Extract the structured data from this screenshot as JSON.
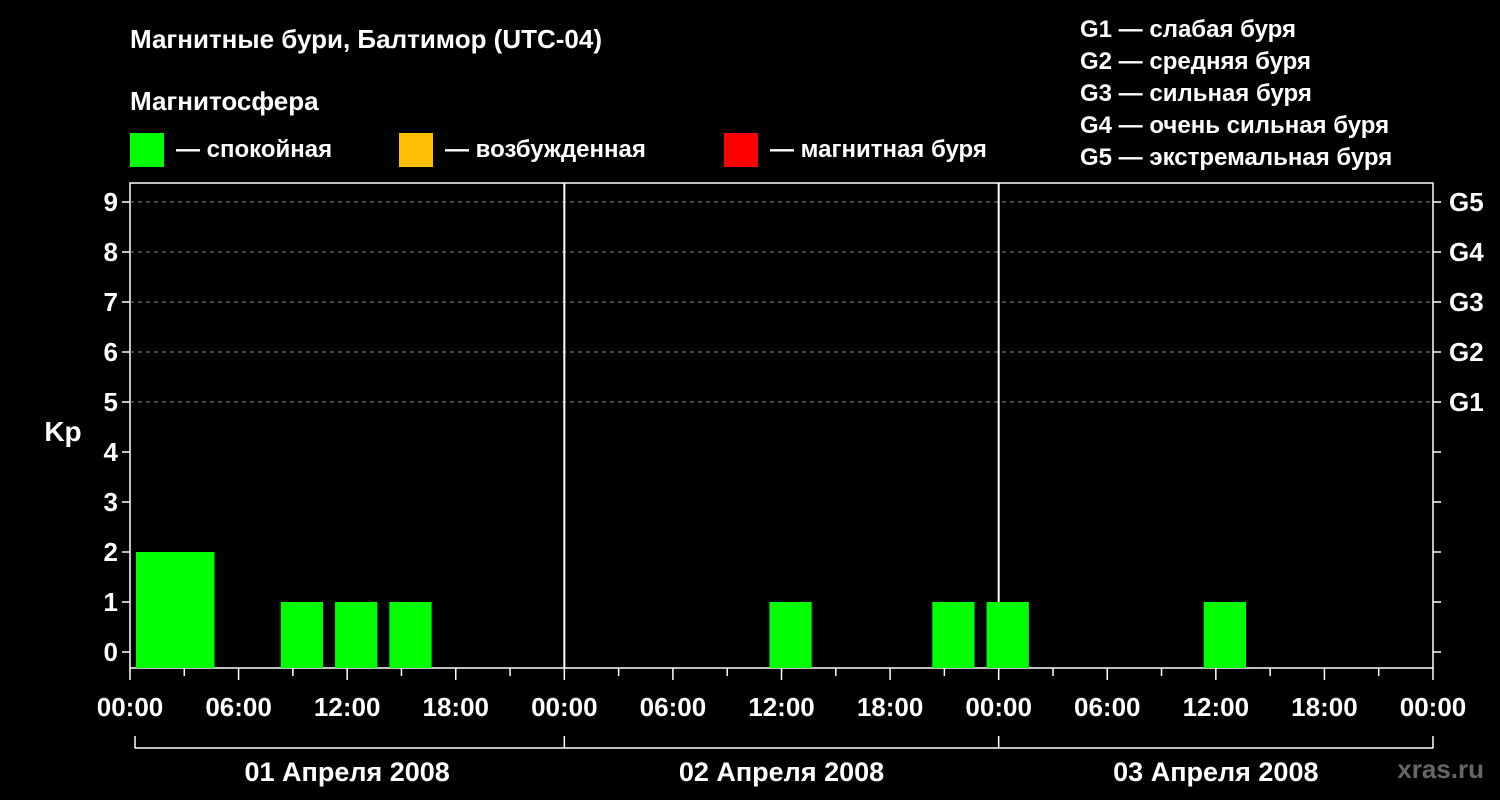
{
  "title": "Магнитные бури, Балтимор (UTC-04)",
  "subtitle": "Магнитосфера",
  "legend": [
    {
      "label": "— спокойная",
      "color": "#00ff00"
    },
    {
      "label": "— возбужденная",
      "color": "#ffbf00"
    },
    {
      "label": "— магнитная буря",
      "color": "#ff0000"
    }
  ],
  "scale": [
    "G1 — слабая буря",
    "G2 — средняя буря",
    "G3 — сильная буря",
    "G4 — очень сильная буря",
    "G5 — экстремальная буря"
  ],
  "watermark": "xras.ru",
  "chart_data": {
    "type": "bar",
    "ylabel": "Kp",
    "ylim": [
      0,
      9
    ],
    "yticks": [
      "0",
      "1",
      "2",
      "3",
      "4",
      "5",
      "6",
      "7",
      "8",
      "9"
    ],
    "right_labels": [
      {
        "y": 5,
        "label": "G1"
      },
      {
        "y": 6,
        "label": "G2"
      },
      {
        "y": 7,
        "label": "G3"
      },
      {
        "y": 8,
        "label": "G4"
      },
      {
        "y": 9,
        "label": "G5"
      }
    ],
    "x_range_hours": [
      0,
      72
    ],
    "xticks": [
      "00:00",
      "06:00",
      "12:00",
      "18:00",
      "00:00",
      "06:00",
      "12:00",
      "18:00",
      "00:00",
      "06:00",
      "12:00",
      "18:00",
      "00:00"
    ],
    "days": [
      "01 Апреля 2008",
      "02 Апреля 2008",
      "03 Апреля 2008"
    ],
    "grid": "dashed horizontal at 5-9",
    "bars": [
      {
        "start_hour": 0,
        "kp": 2,
        "status": "спокойная",
        "color": "#00ff00"
      },
      {
        "start_hour": 2,
        "kp": 2,
        "status": "спокойная",
        "color": "#00ff00"
      },
      {
        "start_hour": 8,
        "kp": 1,
        "status": "спокойная",
        "color": "#00ff00"
      },
      {
        "start_hour": 11,
        "kp": 1,
        "status": "спокойная",
        "color": "#00ff00"
      },
      {
        "start_hour": 14,
        "kp": 1,
        "status": "спокойная",
        "color": "#00ff00"
      },
      {
        "start_hour": 35,
        "kp": 1,
        "status": "спокойная",
        "color": "#00ff00"
      },
      {
        "start_hour": 44,
        "kp": 1,
        "status": "спокойная",
        "color": "#00ff00"
      },
      {
        "start_hour": 47,
        "kp": 1,
        "status": "спокойная",
        "color": "#00ff00"
      },
      {
        "start_hour": 59,
        "kp": 1,
        "status": "спокойная",
        "color": "#00ff00"
      }
    ]
  }
}
